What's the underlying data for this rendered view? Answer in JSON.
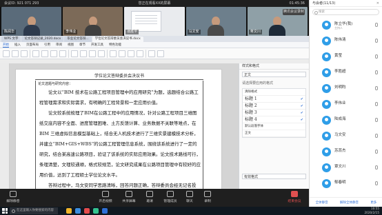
{
  "meeting": {
    "meeting_id": "会议ID: 921 071 293",
    "status": "您正在观看XX的屏幕",
    "time": "01:45:36",
    "record_label": "腾讯会议录制",
    "participants": [
      "陈阅华",
      "李伟业",
      "张胜平",
      "马文安",
      "蒋文川"
    ]
  },
  "wps": {
    "tabs": [
      "WPS 文字",
      "论文答辩记录_2020.docx",
      "毕业论文答辩...",
      "学位论文答辩委员会决议书.docx"
    ],
    "menu": [
      "开始",
      "插入",
      "页面布局",
      "引用",
      "审阅",
      "视图",
      "章节",
      "开发工具",
      "特色功能"
    ],
    "active_menu": "开始",
    "page_header": "学位论文答辩委员会决议书",
    "section_label": "论文选题与研究内容：",
    "paragraphs": [
      "论文以“BIM 技术在公路工程项目管理中的应用研究”为题，选题结合公路工程管理需求和实际需求，有明确的工程背景和一定应用价值。",
      "论文较系统梳理了BIM在公路工程中的应用情况，针对公路工程项目三维图纸交底内容不全面、进度管理困难、土方反馈计算、业务数据不关联等难点，在BIM 三维虚拟信息模型基础上，结合无人机技术进行了三维实景建模技术分析，并建立“BIM+GIS+WBS”的公路工程管理信息系统，围绕该系统进行了一定的研究，结合某高速公路项目，验证了该系统的实际应用效果。论文技术路线可行，条理清楚，文理较通顺，格式较规范，论文研究成果在公路项目管理中有较好的应用价值，达到了工程硕士学位论文水平。",
      "答辩过程中，马文安同学思路清晰，回答问题正确，答辩委员会经无记名投"
    ],
    "nav_title": "样式和格式",
    "nav_style_current": "正文",
    "nav_select_label": "请选择要应用的格式",
    "nav_items": [
      "清除格式",
      "标题 1",
      "标题 2",
      "标题 3",
      "标题 4",
      "默认段落字体",
      "正文"
    ],
    "nav_show": "有效格式"
  },
  "toolbar": {
    "buttons": [
      "解除静音",
      "开启视频",
      "共享屏幕",
      "邀请",
      "管理成员",
      "聊天",
      "录制",
      "结束会议"
    ]
  },
  "taskbar": {
    "search_placeholder": "在这里输入你要搜索的内容",
    "clock": "10:55",
    "date": "2020/2/15",
    "app_colors": [
      "#f0b429",
      "#3c8dde",
      "#e34b4b",
      "#34c38f",
      "#2f6fd6"
    ]
  },
  "panel": {
    "title": "与会者(11/13)",
    "search_placeholder": "搜索",
    "members": [
      {
        "name": "陈立华(我)",
        "status": "主持人"
      },
      {
        "name": "陈伟清",
        "status": ""
      },
      {
        "name": "黄莹",
        "status": ""
      },
      {
        "name": "李胜超",
        "status": ""
      },
      {
        "name": "刘明昀",
        "status": ""
      },
      {
        "name": "李伟业",
        "status": ""
      },
      {
        "name": "陆成海",
        "status": ""
      },
      {
        "name": "马文安",
        "status": ""
      },
      {
        "name": "苏蕊杰",
        "status": ""
      },
      {
        "name": "覃文川",
        "status": ""
      },
      {
        "name": "郁春明",
        "status": ""
      },
      {
        "name": "刘蓝",
        "status": ""
      }
    ],
    "footer": [
      "全体静音",
      "解除全体静音",
      "更多"
    ]
  }
}
